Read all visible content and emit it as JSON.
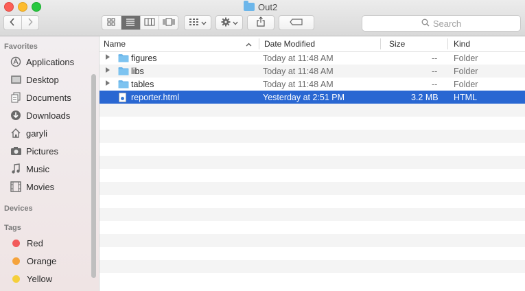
{
  "window": {
    "title": "Out2",
    "folder_icon": "folder-icon"
  },
  "toolbar": {
    "back_icon": "chevron-left-icon",
    "forward_icon": "chevron-right-icon",
    "views": [
      "icon-view",
      "list-view",
      "column-view",
      "coverflow-view"
    ],
    "active_view": "list-view",
    "search_placeholder": "Search"
  },
  "sidebar": {
    "favorites_header": "Favorites",
    "favorites": [
      {
        "label": "Applications",
        "icon": "applications-icon"
      },
      {
        "label": "Desktop",
        "icon": "desktop-icon"
      },
      {
        "label": "Documents",
        "icon": "documents-icon"
      },
      {
        "label": "Downloads",
        "icon": "downloads-icon"
      },
      {
        "label": "garyli",
        "icon": "home-icon"
      },
      {
        "label": "Pictures",
        "icon": "camera-icon"
      },
      {
        "label": "Music",
        "icon": "music-icon"
      },
      {
        "label": "Movies",
        "icon": "film-icon"
      }
    ],
    "devices_header": "Devices",
    "tags_header": "Tags",
    "tags": [
      {
        "label": "Red",
        "color": "#f25b5b"
      },
      {
        "label": "Orange",
        "color": "#f5a33b"
      },
      {
        "label": "Yellow",
        "color": "#f5cf3b"
      }
    ]
  },
  "columns": {
    "name": "Name",
    "date": "Date Modified",
    "size": "Size",
    "kind": "Kind"
  },
  "files": [
    {
      "name": "figures",
      "date": "Today at 11:48 AM",
      "size": "--",
      "kind": "Folder",
      "type": "folder"
    },
    {
      "name": "libs",
      "date": "Today at 11:48 AM",
      "size": "--",
      "kind": "Folder",
      "type": "folder"
    },
    {
      "name": "tables",
      "date": "Today at 11:48 AM",
      "size": "--",
      "kind": "Folder",
      "type": "folder"
    },
    {
      "name": "reporter.html",
      "date": "Yesterday at 2:51 PM",
      "size": "3.2 MB",
      "kind": "HTML",
      "type": "file",
      "selected": true
    }
  ],
  "colors": {
    "selection": "#2967d2",
    "folder": "#6cb6ea"
  }
}
